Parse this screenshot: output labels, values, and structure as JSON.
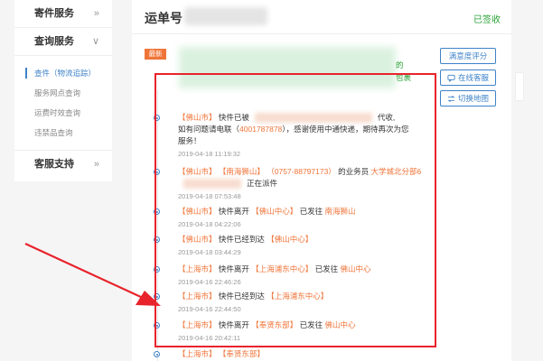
{
  "sidebar": {
    "sections": [
      {
        "label": "寄件服务",
        "chevron": "»"
      },
      {
        "label": "查询服务",
        "chevron": "∨"
      },
      {
        "label": "客服支持",
        "chevron": "»"
      }
    ],
    "sub_items": [
      {
        "label": "查件（物流追踪）",
        "active": true
      },
      {
        "label": "服务网点查询",
        "active": false
      },
      {
        "label": "运费时效查询",
        "active": false
      },
      {
        "label": "违禁品查询",
        "active": false
      }
    ]
  },
  "main": {
    "title": "运单号",
    "status": "已签收",
    "badge": "最新",
    "latest_fragments": [
      "的",
      "包裹"
    ],
    "buttons": {
      "rate": "满意度评分",
      "online_service": "在线客服",
      "switch_map": "切换地图"
    }
  },
  "timeline": [
    {
      "parts": [
        {
          "text": "【佛山市】",
          "style": "org"
        },
        {
          "text": " 快件已被",
          "style": "plain"
        },
        {
          "text": "",
          "style": "blur"
        },
        {
          "text": "代收,",
          "style": "plain"
        }
      ],
      "line2": [
        {
          "text": "如有问题请电联（",
          "style": "plain"
        },
        {
          "text": "4001787878",
          "style": "org"
        },
        {
          "text": "），感谢使用中通快递，期待再次为您",
          "style": "plain"
        }
      ],
      "line3": "服务！",
      "time": "2019-04-18 11:19:32"
    },
    {
      "parts": [
        {
          "text": "【佛山市】",
          "style": "org"
        },
        {
          "text": " 【南海狮山】",
          "style": "org"
        },
        {
          "text": " （0757-88797173）",
          "style": "org"
        },
        {
          "text": " 的业务员 ",
          "style": "plain"
        },
        {
          "text": "大学城北分部6",
          "style": "org"
        }
      ],
      "line2": [
        {
          "text": "",
          "style": "blur-short"
        },
        {
          "text": "正在派件",
          "style": "plain"
        }
      ],
      "time": "2019-04-18 07:53:48"
    },
    {
      "parts": [
        {
          "text": "【佛山市】",
          "style": "org"
        },
        {
          "text": " 快件离开 ",
          "style": "plain"
        },
        {
          "text": "【佛山中心】",
          "style": "org"
        },
        {
          "text": " 已发往 ",
          "style": "plain"
        },
        {
          "text": "南海狮山",
          "style": "org"
        }
      ],
      "time": "2019-04-18 04:22:06"
    },
    {
      "parts": [
        {
          "text": "【佛山市】",
          "style": "org"
        },
        {
          "text": " 快件已经到达 ",
          "style": "plain"
        },
        {
          "text": "【佛山中心】",
          "style": "org"
        }
      ],
      "time": "2019-04-18 03:44:29"
    },
    {
      "parts": [
        {
          "text": "【上海市】",
          "style": "org"
        },
        {
          "text": " 快件离开 ",
          "style": "plain"
        },
        {
          "text": "【上海浦东中心】",
          "style": "org"
        },
        {
          "text": " 已发往 ",
          "style": "plain"
        },
        {
          "text": "佛山中心",
          "style": "org"
        }
      ],
      "time": "2019-04-16 22:46:26"
    },
    {
      "parts": [
        {
          "text": "【上海市】",
          "style": "org"
        },
        {
          "text": " 快件已经到达 ",
          "style": "plain"
        },
        {
          "text": "【上海浦东中心】",
          "style": "org"
        }
      ],
      "time": "2019-04-16 22:44:50"
    },
    {
      "parts": [
        {
          "text": "【上海市】",
          "style": "org"
        },
        {
          "text": " 快件离开 ",
          "style": "plain"
        },
        {
          "text": "【奉贤东部】",
          "style": "org"
        },
        {
          "text": " 已发往 ",
          "style": "plain"
        },
        {
          "text": "佛山中心",
          "style": "org"
        }
      ],
      "time": "2019-04-16 20:42:11"
    },
    {
      "parts": [
        {
          "text": "【上海市】",
          "style": "org"
        },
        {
          "text": " 【奉贤东部】",
          "style": "org"
        }
      ],
      "time": ""
    }
  ],
  "colors": {
    "accent": "#3d82c9",
    "org": "#f07438",
    "signed": "#2aa336",
    "annotation_red": "#e8232c"
  }
}
